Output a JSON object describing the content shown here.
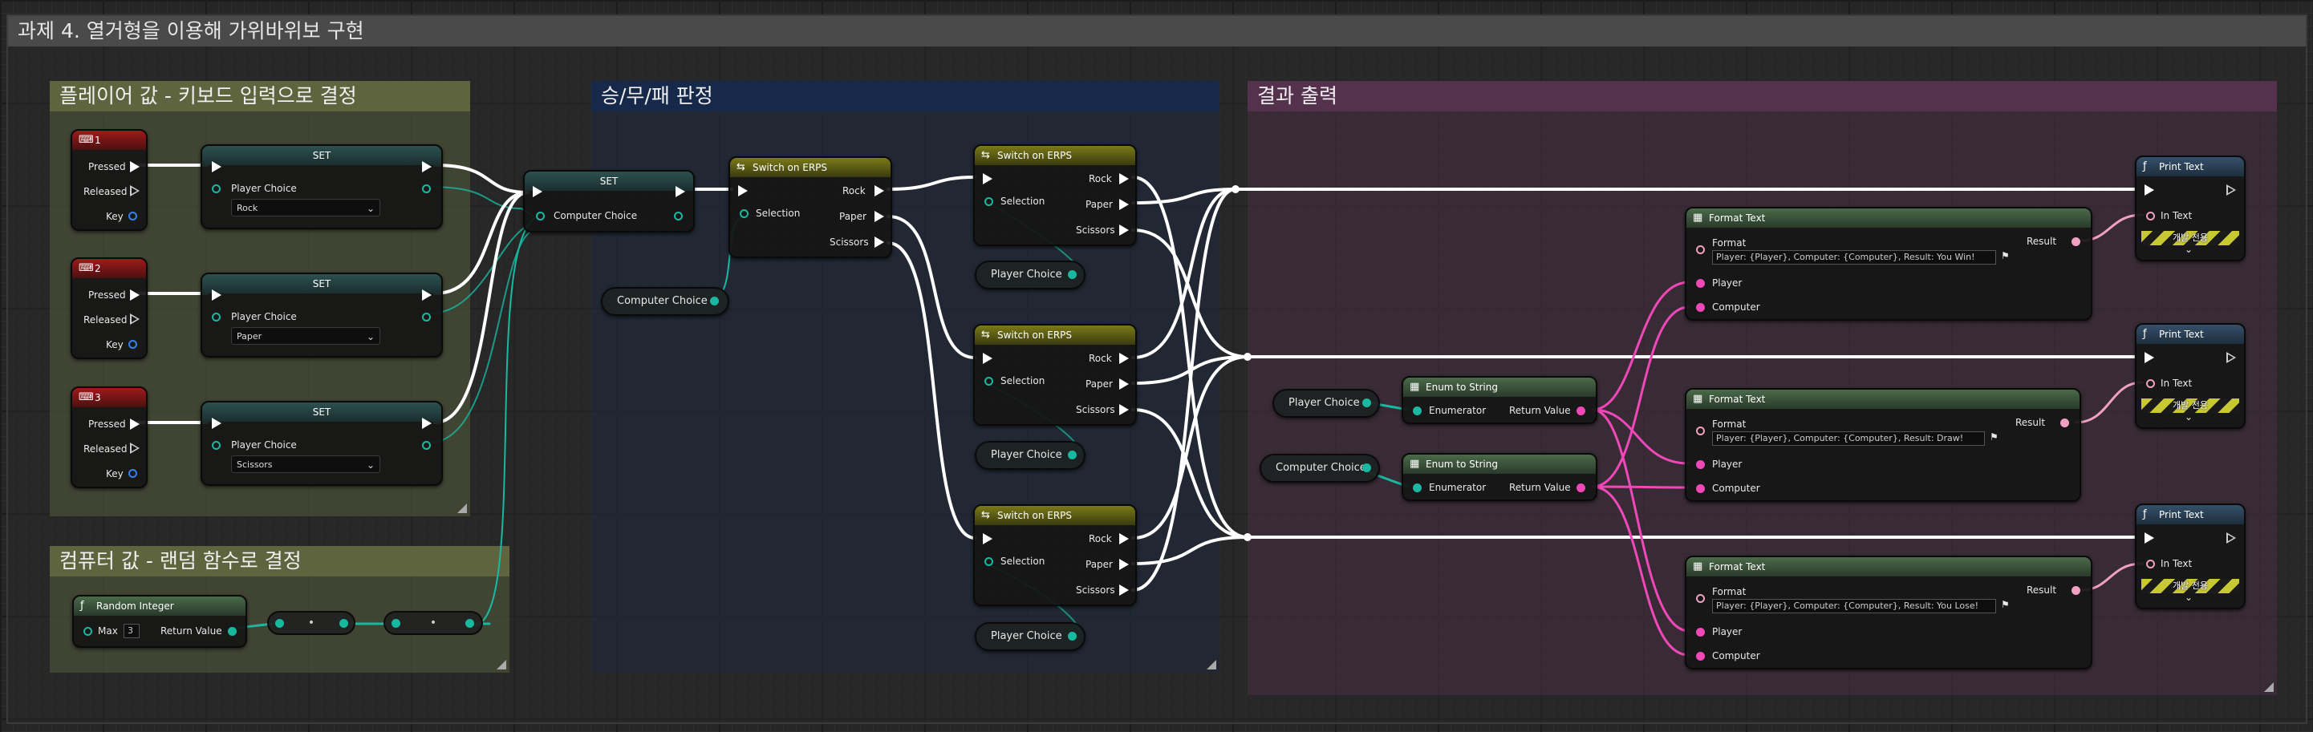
{
  "graph_title": "과제 4. 열거형을 이용해 가위바위보 구현",
  "comments": {
    "player": "플레이어 값 - 키보드 입력으로 결정",
    "judge": "승/무/패 판정",
    "output": "결과 출력",
    "computer": "컴퓨터 값 - 랜덤 함수로 결정"
  },
  "colors": {
    "player_comment": "#565c3e",
    "judge_comment": "#1d2f4a",
    "output_comment": "#4e3048",
    "exec_wire": "#ffffff",
    "enum_wire": "#19b8a0",
    "string_wire": "#f048b8",
    "text_wire": "#f0a0c0"
  },
  "key_events": [
    {
      "key": "1",
      "pins": [
        "Pressed",
        "Released",
        "Key"
      ]
    },
    {
      "key": "2",
      "pins": [
        "Pressed",
        "Released",
        "Key"
      ]
    },
    {
      "key": "3",
      "pins": [
        "Pressed",
        "Released",
        "Key"
      ]
    }
  ],
  "set_nodes": [
    {
      "title": "SET",
      "var": "Player Choice",
      "value": "Rock"
    },
    {
      "title": "SET",
      "var": "Player Choice",
      "value": "Paper"
    },
    {
      "title": "SET",
      "var": "Player Choice",
      "value": "Scissors"
    }
  ],
  "set_computer": {
    "title": "SET",
    "var": "Computer Choice"
  },
  "random_integer": {
    "title": "Random Integer",
    "max_label": "Max",
    "max_value": "3",
    "output": "Return Value"
  },
  "reroute_labels": [
    "•",
    "•"
  ],
  "computer_choice_getter": "Computer Choice",
  "switch_main": {
    "title": "Switch on ERPS",
    "selection": "Selection",
    "outputs": [
      "Rock",
      "Paper",
      "Scissors"
    ]
  },
  "switches": [
    {
      "title": "Switch on ERPS",
      "selection": "Selection",
      "outputs": [
        "Rock",
        "Paper",
        "Scissors"
      ],
      "getter": "Player Choice"
    },
    {
      "title": "Switch on ERPS",
      "selection": "Selection",
      "outputs": [
        "Rock",
        "Paper",
        "Scissors"
      ],
      "getter": "Player Choice"
    },
    {
      "title": "Switch on ERPS",
      "selection": "Selection",
      "outputs": [
        "Rock",
        "Paper",
        "Scissors"
      ],
      "getter": "Player Choice"
    }
  ],
  "enum_to_string": [
    {
      "title": "Enum to String",
      "input": "Enumerator",
      "output": "Return Value",
      "getter": "Player Choice"
    },
    {
      "title": "Enum to String",
      "input": "Enumerator",
      "output": "Return Value",
      "getter": "Computer Choice"
    }
  ],
  "format_text": [
    {
      "title": "Format Text",
      "format_label": "Format",
      "format_value": "Player: {Player}, Computer: {Computer}, Result: You Win!",
      "player": "Player",
      "computer": "Computer",
      "result": "Result"
    },
    {
      "title": "Format Text",
      "format_label": "Format",
      "format_value": "Player: {Player}, Computer: {Computer}, Result: Draw!",
      "player": "Player",
      "computer": "Computer",
      "result": "Result"
    },
    {
      "title": "Format Text",
      "format_label": "Format",
      "format_value": "Player: {Player}, Computer: {Computer}, Result: You Lose!",
      "player": "Player",
      "computer": "Computer",
      "result": "Result"
    }
  ],
  "print_text": [
    {
      "title": "Print Text",
      "in_text": "In Text",
      "dev_only": "개발 전용"
    },
    {
      "title": "Print Text",
      "in_text": "In Text",
      "dev_only": "개발 전용"
    },
    {
      "title": "Print Text",
      "in_text": "In Text",
      "dev_only": "개발 전용"
    }
  ]
}
